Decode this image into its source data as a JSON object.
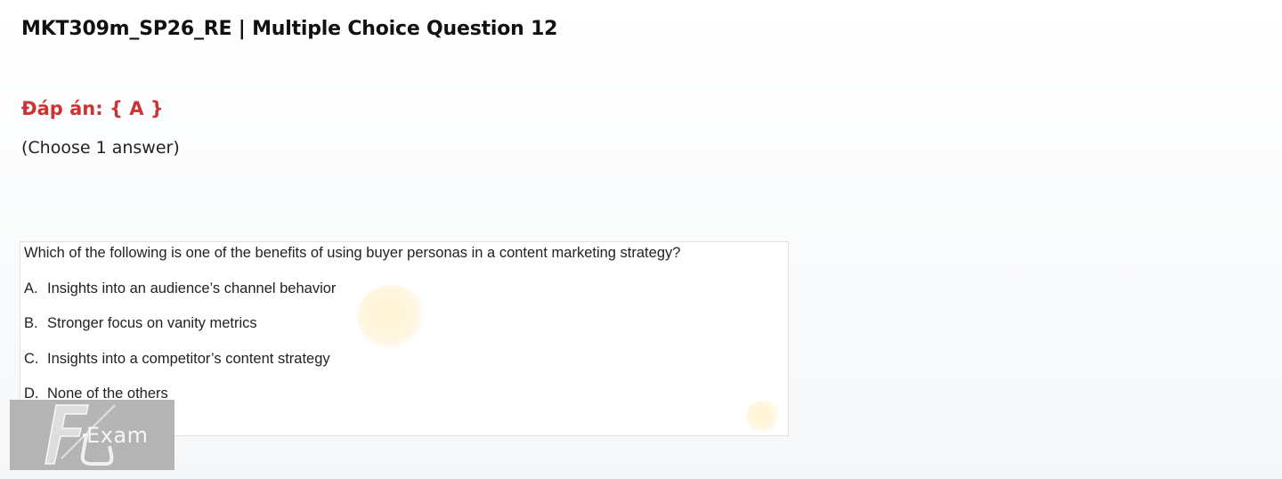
{
  "header": {
    "title": "MKT309m_SP26_RE | Multiple Choice Question 12"
  },
  "answer": {
    "label": "Đáp án: { A }"
  },
  "instruction": {
    "text": "(Choose 1 answer)"
  },
  "question": {
    "stem": "Which of the following is one of the benefits of using buyer personas in a content marketing strategy?",
    "options": [
      {
        "letter": "A.",
        "text": "Insights into an audience’s channel behavior"
      },
      {
        "letter": "B.",
        "text": "Stronger focus on vanity metrics"
      },
      {
        "letter": "C.",
        "text": "Insights into a competitor’s content strategy"
      },
      {
        "letter": "D.",
        "text": "None of the others"
      }
    ]
  },
  "watermark": {
    "text": "Exam",
    "logo_letters": "FU"
  },
  "colors": {
    "answer": "#cc3333",
    "title": "#111111",
    "watermark_bg": "#a5a5a5"
  }
}
